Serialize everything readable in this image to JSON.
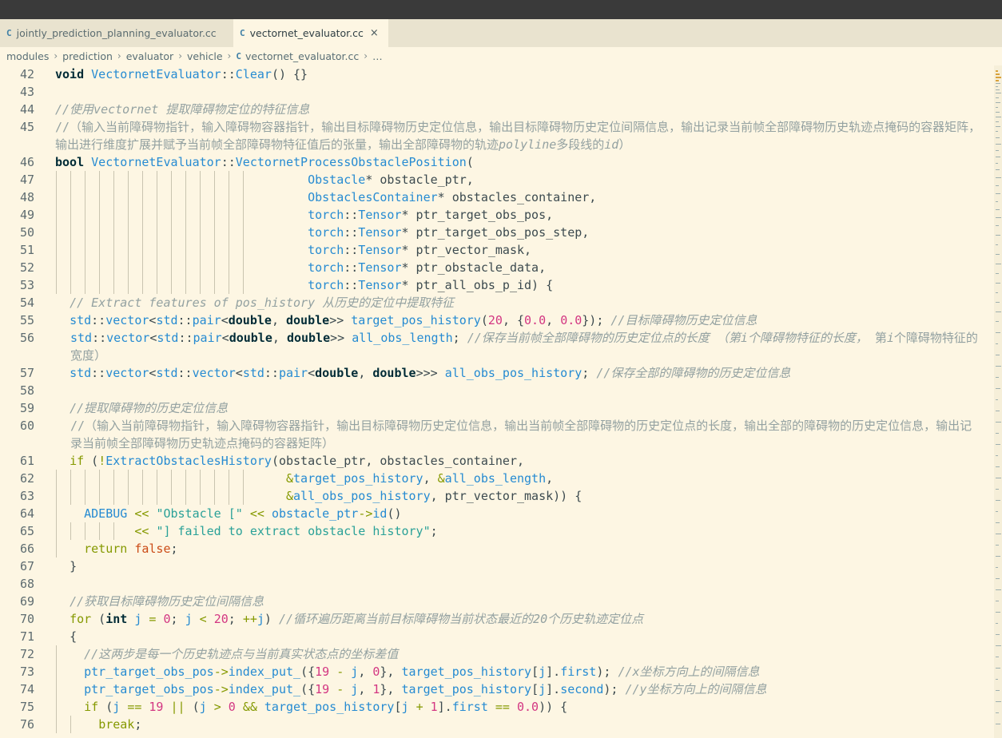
{
  "tabs": [
    {
      "icon": "C",
      "label": "jointly_prediction_planning_evaluator.cc",
      "active": false
    },
    {
      "icon": "C",
      "label": "vectornet_evaluator.cc",
      "active": true,
      "close": "×"
    }
  ],
  "breadcrumb": {
    "items": [
      "modules",
      "prediction",
      "evaluator",
      "vehicle"
    ],
    "file": "vectornet_evaluator.cc",
    "sep": "›",
    "ellipsis": "…"
  },
  "lines": [
    {
      "n": "42",
      "html": "<span class='k'>void</span> <span class='t'>VectornetEvaluator</span><span class='p'>::</span><span class='f'>Clear</span><span class='p'>() {}</span>"
    },
    {
      "n": "43",
      "html": ""
    },
    {
      "n": "44",
      "html": "<span class='c'>//使用vectornet 提取障碍物定位的特征信息</span>"
    },
    {
      "n": "45",
      "wrap": true,
      "html": "<span class='cz'>//（输入当前障碍物指针，输入障碍物容器指针，输出目标障碍物历史定位信息，输出目标障碍物历史定位间隔信息，输出记录当前帧全部障碍物历史轨迹点掩码的容器矩阵，输出进行维度扩展并赋予当前帧全部障碍物特征值后的张量，输出全部障碍物的轨迹<i>polyline</i>多段线的<i>id</i>）</span>"
    },
    {
      "n": "46",
      "html": "<span class='k'>bool</span> <span class='t'>VectornetEvaluator</span><span class='p'>::</span><span class='f'>VectornetProcessObstaclePosition</span><span class='p'>(</span>"
    },
    {
      "n": "47",
      "guides": 14,
      "html": "                                   <span class='t'>Obstacle</span><span class='p'>* obstacle_ptr,</span>"
    },
    {
      "n": "48",
      "guides": 14,
      "html": "                                   <span class='t'>ObstaclesContainer</span><span class='p'>* obstacles_container,</span>"
    },
    {
      "n": "49",
      "guides": 14,
      "html": "                                   <span class='t'>torch</span><span class='p'>::</span><span class='t'>Tensor</span><span class='p'>* ptr_target_obs_pos,</span>"
    },
    {
      "n": "50",
      "guides": 14,
      "html": "                                   <span class='t'>torch</span><span class='p'>::</span><span class='t'>Tensor</span><span class='p'>* ptr_target_obs_pos_step,</span>"
    },
    {
      "n": "51",
      "guides": 14,
      "html": "                                   <span class='t'>torch</span><span class='p'>::</span><span class='t'>Tensor</span><span class='p'>* ptr_vector_mask,</span>"
    },
    {
      "n": "52",
      "guides": 14,
      "html": "                                   <span class='t'>torch</span><span class='p'>::</span><span class='t'>Tensor</span><span class='p'>* ptr_obstacle_data,</span>"
    },
    {
      "n": "53",
      "guides": 14,
      "html": "                                   <span class='t'>torch</span><span class='p'>::</span><span class='t'>Tensor</span><span class='p'>* ptr_all_obs_p_id) {</span>"
    },
    {
      "n": "54",
      "html": "  <span class='c'>// Extract features of pos_history 从历史的定位中提取特征</span>"
    },
    {
      "n": "55",
      "html": "  <span class='t'>std</span><span class='p'>::</span><span class='t'>vector</span><span class='p'>&lt;</span><span class='t'>std</span><span class='p'>::</span><span class='t'>pair</span><span class='p'>&lt;</span><span class='k'>double</span><span class='p'>, </span><span class='k'>double</span><span class='p'>&gt;&gt; </span><span class='f'>target_pos_history</span><span class='p'>(</span><span class='n'>20</span><span class='p'>, {</span><span class='n'>0.0</span><span class='p'>, </span><span class='n'>0.0</span><span class='p'>}); </span><span class='c'>//目标障碍物历史定位信息</span>"
    },
    {
      "n": "56",
      "wrap": true,
      "indent": 19,
      "html": "<span class='t'>std</span><span class='p'>::</span><span class='t'>vector</span><span class='p'>&lt;</span><span class='t'>std</span><span class='p'>::</span><span class='t'>pair</span><span class='p'>&lt;</span><span class='k'>double</span><span class='p'>, </span><span class='k'>double</span><span class='p'>&gt;&gt; </span><span class='f'>all_obs_length</span><span class='p'>; </span><span class='cz'><i>//保存当前帧全部障碍物的历史定位点的长度 （第i个障碍物特征的长度，</i> 第<i>i</i>个障碍物特征的宽度）</span>"
    },
    {
      "n": "57",
      "html": "  <span class='t'>std</span><span class='p'>::</span><span class='t'>vector</span><span class='p'>&lt;</span><span class='t'>std</span><span class='p'>::</span><span class='t'>vector</span><span class='p'>&lt;</span><span class='t'>std</span><span class='p'>::</span><span class='t'>pair</span><span class='p'>&lt;</span><span class='k'>double</span><span class='p'>, </span><span class='k'>double</span><span class='p'>&gt;&gt;&gt; </span><span class='f'>all_obs_pos_history</span><span class='p'>; </span><span class='c'>//保存全部的障碍物的历史定位信息</span>"
    },
    {
      "n": "58",
      "html": ""
    },
    {
      "n": "59",
      "html": "  <span class='c'>//提取障碍物的历史定位信息</span>"
    },
    {
      "n": "60",
      "wrap": true,
      "indent": 19,
      "html": "<span class='cz'>//（输入当前障碍物指针，输入障碍物容器指针，输出目标障碍物历史定位信息，输出当前帧全部障碍物的历史定位点的长度，输出全部的障碍物的历史定位信息，输出记录当前帧全部障碍物历史轨迹点掩码的容器矩阵）</span>"
    },
    {
      "n": "61",
      "html": "  <span class='kw'>if</span><span class='p'> (</span><span class='o'>!</span><span class='f'>ExtractObstaclesHistory</span><span class='p'>(obstacle_ptr, obstacles_container,</span>"
    },
    {
      "n": "62",
      "guides": 14,
      "html": "                                <span class='o'>&amp;</span><span class='f'>target_pos_history</span><span class='p'>, </span><span class='o'>&amp;</span><span class='f'>all_obs_length</span><span class='p'>,</span>"
    },
    {
      "n": "63",
      "guides": 14,
      "html": "                                <span class='o'>&amp;</span><span class='f'>all_obs_pos_history</span><span class='p'>, ptr_vector_mask)) {</span>"
    },
    {
      "n": "64",
      "guides": 1,
      "html": "    <span class='t'>ADEBUG</span><span class='p'> </span><span class='o'>&lt;&lt;</span><span class='p'> </span><span class='s'>\"Obstacle [\"</span><span class='p'> </span><span class='o'>&lt;&lt;</span><span class='p'> </span><span class='t'>obstacle_ptr</span><span class='o'>-&gt;</span><span class='f'>id</span><span class='p'>()</span>"
    },
    {
      "n": "65",
      "guides": 5,
      "html": "           <span class='o'>&lt;&lt;</span><span class='p'> </span><span class='s'>\"] failed to extract obstacle history\"</span><span class='p'>;</span>"
    },
    {
      "n": "66",
      "guides": 1,
      "html": "    <span class='kw'>return</span><span class='p'> </span><span class='b'>false</span><span class='p'>;</span>"
    },
    {
      "n": "67",
      "html": "  <span class='p'>}</span>"
    },
    {
      "n": "68",
      "html": ""
    },
    {
      "n": "69",
      "html": "  <span class='c'>//获取目标障碍物历史定位间隔信息</span>"
    },
    {
      "n": "70",
      "html": "  <span class='kw'>for</span><span class='p'> (</span><span class='k'>int</span><span class='p'> </span><span class='f'>j</span><span class='p'> </span><span class='o'>=</span><span class='p'> </span><span class='n'>0</span><span class='p'>; </span><span class='f'>j</span><span class='p'> </span><span class='o'>&lt;</span><span class='p'> </span><span class='n'>20</span><span class='p'>; </span><span class='o'>++</span><span class='f'>j</span><span class='p'>) </span><span class='c'>//循环遍历距离当前目标障碍物当前状态最近的20个历史轨迹定位点</span>"
    },
    {
      "n": "71",
      "html": "  <span class='p'>{</span>"
    },
    {
      "n": "72",
      "guides": 1,
      "html": "    <span class='c'>//这两步是每一个历史轨迹点与当前真实状态点的坐标差值</span>"
    },
    {
      "n": "73",
      "guides": 1,
      "html": "    <span class='f'>ptr_target_obs_pos</span><span class='o'>-&gt;</span><span class='f'>index_put_</span><span class='p'>({</span><span class='n'>19</span><span class='p'> </span><span class='o'>-</span><span class='p'> </span><span class='f'>j</span><span class='p'>, </span><span class='n'>0</span><span class='p'>}, </span><span class='f'>target_pos_history</span><span class='p'>[</span><span class='f'>j</span><span class='p'>].</span><span class='f'>first</span><span class='p'>); </span><span class='c'>//x坐标方向上的间隔信息</span>"
    },
    {
      "n": "74",
      "guides": 1,
      "html": "    <span class='f'>ptr_target_obs_pos</span><span class='o'>-&gt;</span><span class='f'>index_put_</span><span class='p'>({</span><span class='n'>19</span><span class='p'> </span><span class='o'>-</span><span class='p'> </span><span class='f'>j</span><span class='p'>, </span><span class='n'>1</span><span class='p'>}, </span><span class='f'>target_pos_history</span><span class='p'>[</span><span class='f'>j</span><span class='p'>].</span><span class='f'>second</span><span class='p'>); </span><span class='c'>//y坐标方向上的间隔信息</span>"
    },
    {
      "n": "75",
      "guides": 1,
      "html": "    <span class='kw'>if</span><span class='p'> (</span><span class='f'>j</span><span class='p'> </span><span class='o'>==</span><span class='p'> </span><span class='n'>19</span><span class='p'> </span><span class='o'>||</span><span class='p'> (</span><span class='f'>j</span><span class='p'> </span><span class='o'>&gt;</span><span class='p'> </span><span class='n'>0</span><span class='p'> </span><span class='o'>&amp;&amp;</span><span class='p'> </span><span class='f'>target_pos_history</span><span class='p'>[</span><span class='f'>j</span><span class='p'> </span><span class='o'>+</span><span class='p'> </span><span class='n'>1</span><span class='p'>].</span><span class='f'>first</span><span class='p'> </span><span class='o'>==</span><span class='p'> </span><span class='n'>0.0</span><span class='p'>)) {</span>"
    },
    {
      "n": "76",
      "guides": 2,
      "html": "      <span class='kw'>break</span><span class='p'>;</span>"
    }
  ]
}
